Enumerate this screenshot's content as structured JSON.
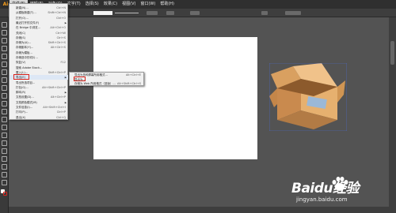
{
  "menubar": {
    "logo": "Ai",
    "items": [
      "文件(F)",
      "编辑(E)",
      "对象(O)",
      "文字(T)",
      "选择(S)",
      "效果(C)",
      "视图(V)",
      "窗口(W)",
      "帮助(H)"
    ]
  },
  "file_menu": {
    "items": [
      {
        "label": "新建(N)...",
        "shortcut": "Ctrl+N"
      },
      {
        "label": "从模板新建(T)...",
        "shortcut": "Shift+Ctrl+N"
      },
      {
        "label": "打开(O)...",
        "shortcut": "Ctrl+O"
      },
      {
        "label": "最近打开的文件(F)",
        "shortcut": "▶"
      },
      {
        "label": "在 Bridge 中浏览...",
        "shortcut": "Alt+Ctrl+O"
      },
      {
        "label": "关闭(C)",
        "shortcut": "Ctrl+W"
      },
      {
        "label": "存储(S)",
        "shortcut": "Ctrl+S"
      },
      {
        "label": "存储为(A)...",
        "shortcut": "Shift+Ctrl+S"
      },
      {
        "label": "存储副本(Y)...",
        "shortcut": "Alt+Ctrl+S"
      },
      {
        "label": "存储为模板...",
        "shortcut": ""
      },
      {
        "label": "存储选中的切片...",
        "shortcut": ""
      },
      {
        "label": "恢复(V)",
        "shortcut": "F12"
      },
      {
        "label": "搜索 Adobe Stock...",
        "shortcut": ""
      },
      {
        "label": "置入(L)...",
        "shortcut": "Shift+Ctrl+P"
      },
      {
        "label": "导出(E)",
        "shortcut": "▶"
      },
      {
        "label": "导出所选项目...",
        "shortcut": ""
      },
      {
        "label": "打包(G)...",
        "shortcut": "Alt+Shift+Ctrl+P"
      },
      {
        "label": "脚本(R)",
        "shortcut": "▶"
      },
      {
        "label": "文档设置(D)...",
        "shortcut": "Alt+Ctrl+P"
      },
      {
        "label": "文档颜色模式(M)",
        "shortcut": "▶"
      },
      {
        "label": "文件信息(I)...",
        "shortcut": "Alt+Shift+Ctrl+I"
      },
      {
        "label": "打印(P)...",
        "shortcut": "Ctrl+P"
      },
      {
        "label": "退出(X)",
        "shortcut": "Ctrl+Q"
      }
    ]
  },
  "export_submenu": {
    "items": [
      {
        "label": "导出为多种屏幕所用格式...",
        "shortcut": "Alt+Ctrl+E"
      },
      {
        "label": "导出为...",
        "shortcut": ""
      },
      {
        "label": "存储为 Web 所用格式（旧版）...",
        "shortcut": "Alt+Shift+Ctrl+S"
      }
    ]
  },
  "watermark": {
    "main": "Baidu经验",
    "sub": "jingyan.baidu.com"
  },
  "colors": {
    "workspace": "#535353",
    "highlight_box": "#d9241c",
    "box_fill": "#e0a868"
  }
}
